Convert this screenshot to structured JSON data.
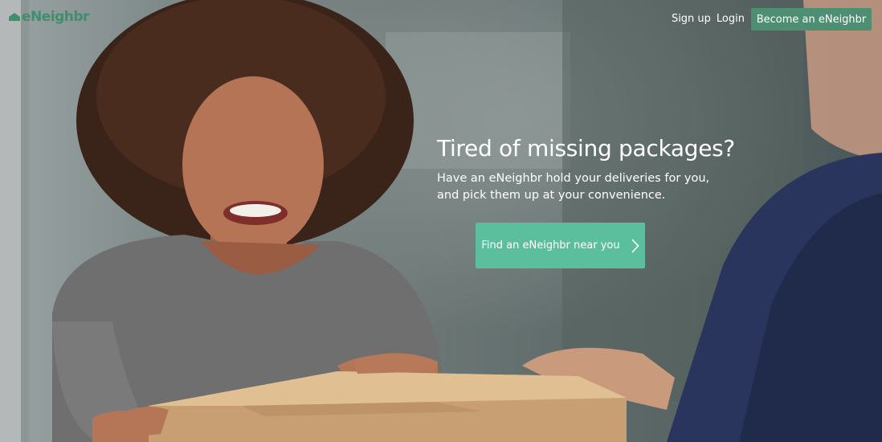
{
  "brand": {
    "logo_text": "eNeighbr",
    "logo_icon": "house-icon",
    "color": "#3f8e6c"
  },
  "nav": {
    "signup_label": "Sign up",
    "login_label": "Login",
    "become_label": "Become an eNeighbr",
    "become_color": "#4e8f73"
  },
  "hero": {
    "headline": "Tired of missing packages?",
    "subhead": "Have an eNeighbr hold your deliveries for you, and pick them up at your convenience.",
    "cta_label": "Find an eNeighbr near you",
    "cta_icon": "chevron-right-icon",
    "cta_color": "#5bbf9d"
  }
}
